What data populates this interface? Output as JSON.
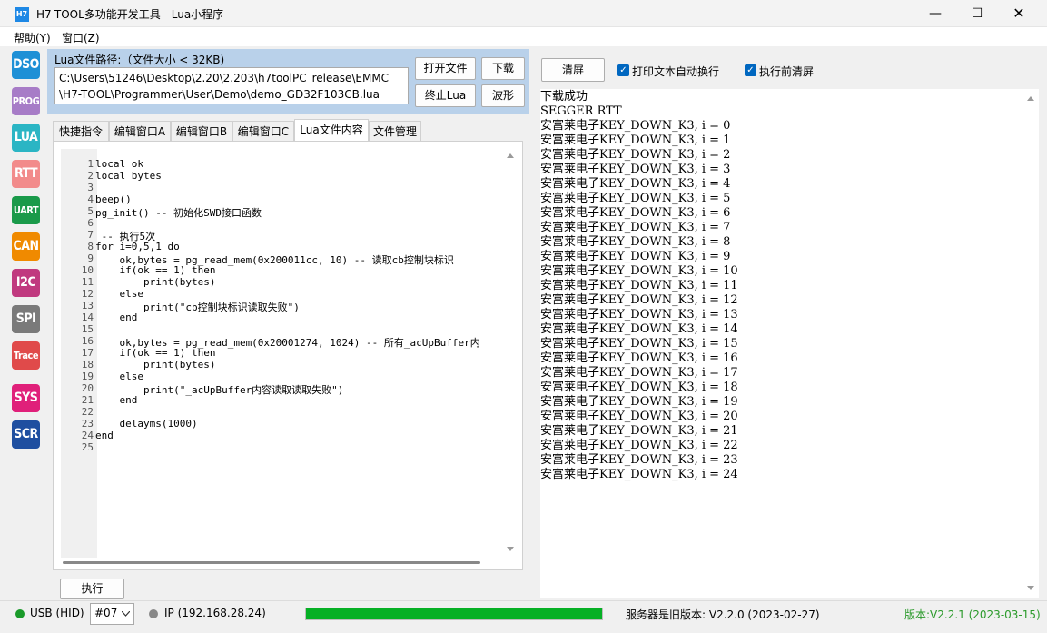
{
  "window": {
    "icon_text": "H7",
    "title": "H7-TOOL多功能开发工具 - Lua小程序",
    "minimize": "—",
    "maximize": "☐",
    "close": "✕"
  },
  "menu": [
    "帮助(Y)",
    "窗口(Z)"
  ],
  "toolbar": [
    {
      "label": "DSO",
      "color": "#1e90d6"
    },
    {
      "label": "PROG",
      "color": "#a77cc7"
    },
    {
      "label": "LUA",
      "color": "#2bb5c4"
    },
    {
      "label": "RTT",
      "color": "#f28b8b"
    },
    {
      "label": "UART",
      "color": "#1a9a4a"
    },
    {
      "label": "CAN",
      "color": "#f08a00"
    },
    {
      "label": "I2C",
      "color": "#c0397f"
    },
    {
      "label": "SPI",
      "color": "#7a7a7a"
    },
    {
      "label": "Trace",
      "color": "#e04a4a"
    },
    {
      "label": "SYS",
      "color": "#e0207a"
    },
    {
      "label": "SCR",
      "color": "#1f4fa0"
    }
  ],
  "lua_path": {
    "label": "Lua文件路径:（文件大小 < 32KB)",
    "line1": "C:\\Users\\51246\\Desktop\\2.20\\2.203\\h7toolPC_release\\EMMC",
    "line2": "\\H7-TOOL\\Programmer\\User\\Demo\\demo_GD32F103CB.lua",
    "open_button": "打开文件",
    "download_button": "下载",
    "stop_button": "终止Lua",
    "wave_button": "波形"
  },
  "tabs": [
    "快捷指令",
    "编辑窗口A",
    "编辑窗口B",
    "编辑窗口C",
    "Lua文件内容",
    "文件管理"
  ],
  "active_tab": 4,
  "code_lines": [
    "local ok",
    "local bytes",
    "",
    "beep()",
    "pg_init() -- 初始化SWD接口函数",
    "",
    " -- 执行5次",
    "for i=0,5,1 do",
    "    ok,bytes = pg_read_mem(0x200011cc, 10) -- 读取cb控制块标识",
    "    if(ok == 1) then",
    "        print(bytes)",
    "    else",
    "        print(\"cb控制块标识读取失败\")",
    "    end",
    "",
    "    ok,bytes = pg_read_mem(0x20001274, 1024) -- 所有_acUpBuffer内",
    "    if(ok == 1) then",
    "        print(bytes)",
    "    else",
    "        print(\"_acUpBuffer内容读取读取失败\")",
    "    end",
    "",
    "    delayms(1000)",
    "end",
    ""
  ],
  "exec_button": "执行",
  "right": {
    "clear_button": "清屏",
    "auto_wrap_label": "打印文本自动换行",
    "clear_before_exec_label": "执行前清屏",
    "output_lines": [
      "下载成功",
      "SEGGER RTT",
      "安富莱电子KEY_DOWN_K3, i = 0",
      "安富莱电子KEY_DOWN_K3, i = 1",
      "安富莱电子KEY_DOWN_K3, i = 2",
      "安富莱电子KEY_DOWN_K3, i = 3",
      "安富莱电子KEY_DOWN_K3, i = 4",
      "安富莱电子KEY_DOWN_K3, i = 5",
      "安富莱电子KEY_DOWN_K3, i = 6",
      "安富莱电子KEY_DOWN_K3, i = 7",
      "安富莱电子KEY_DOWN_K3, i = 8",
      "安富莱电子KEY_DOWN_K3, i = 9",
      "安富莱电子KEY_DOWN_K3, i = 10",
      "安富莱电子KEY_DOWN_K3, i = 11",
      "安富莱电子KEY_DOWN_K3, i = 12",
      "安富莱电子KEY_DOWN_K3, i = 13",
      "安富莱电子KEY_DOWN_K3, i = 14",
      "安富莱电子KEY_DOWN_K3, i = 15",
      "安富莱电子KEY_DOWN_K3, i = 16",
      "安富莱电子KEY_DOWN_K3, i = 17",
      "安富莱电子KEY_DOWN_K3, i = 18",
      "安富莱电子KEY_DOWN_K3, i = 19",
      "安富莱电子KEY_DOWN_K3, i = 20",
      "安富莱电子KEY_DOWN_K3, i = 21",
      "安富莱电子KEY_DOWN_K3, i = 22",
      "安富莱电子KEY_DOWN_K3, i = 23",
      "安富莱电子KEY_DOWN_K3, i = 24"
    ]
  },
  "status": {
    "usb": "USB (HID)",
    "device": "#07",
    "ip": "IP (192.168.28.24)",
    "progress": 1.0,
    "server_version": "服务器是旧版本: V2.2.0 (2023-02-27)",
    "version": "版本:V2.2.1 (2023-03-15)"
  }
}
